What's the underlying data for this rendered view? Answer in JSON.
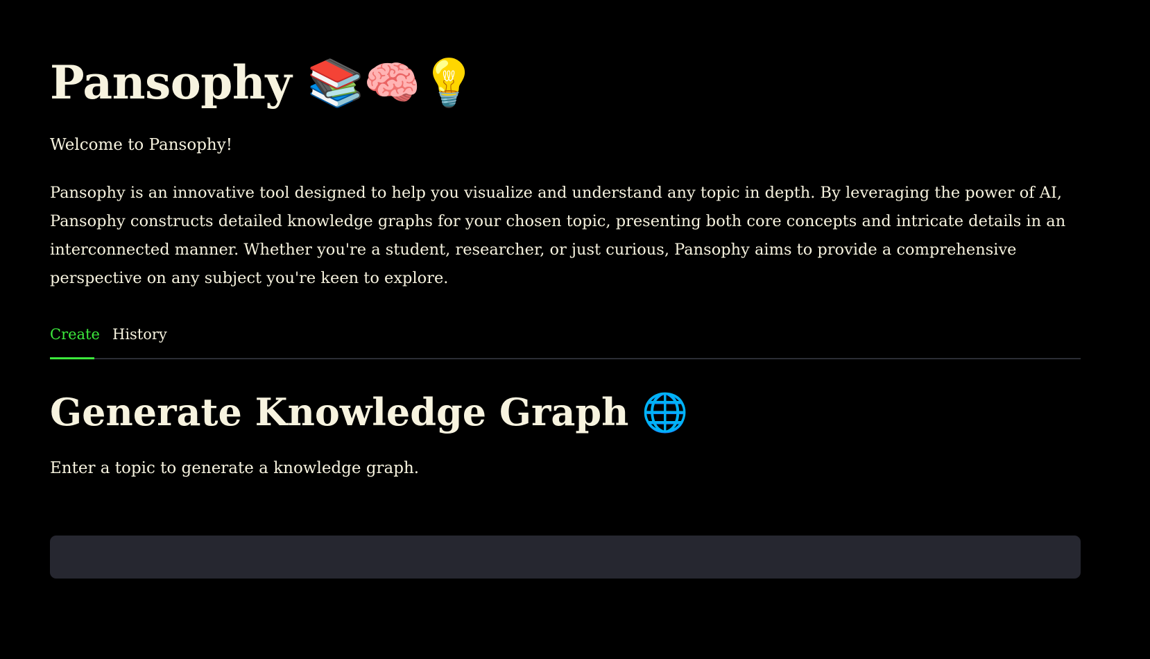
{
  "header": {
    "title": "Pansophy 📚🧠💡",
    "welcome": "Welcome to Pansophy!",
    "intro": "Pansophy is an innovative tool designed to help you visualize and understand any topic in depth. By leveraging the power of AI, Pansophy constructs detailed knowledge graphs for your chosen topic, presenting both core concepts and intricate details in an interconnected manner. Whether you're a student, researcher, or just curious, Pansophy aims to provide a comprehensive perspective on any subject you're keen to explore."
  },
  "tabs": [
    {
      "label": "Create",
      "active": true
    },
    {
      "label": "History",
      "active": false
    }
  ],
  "create": {
    "heading": "Generate Knowledge Graph 🌐",
    "prompt": "Enter a topic to generate a knowledge graph.",
    "input_value": "",
    "input_placeholder": ""
  },
  "colors": {
    "background": "#000000",
    "text": "#f7f3df",
    "accent": "#3ce83c",
    "input_background": "#262730",
    "divider": "#2b2d35"
  }
}
